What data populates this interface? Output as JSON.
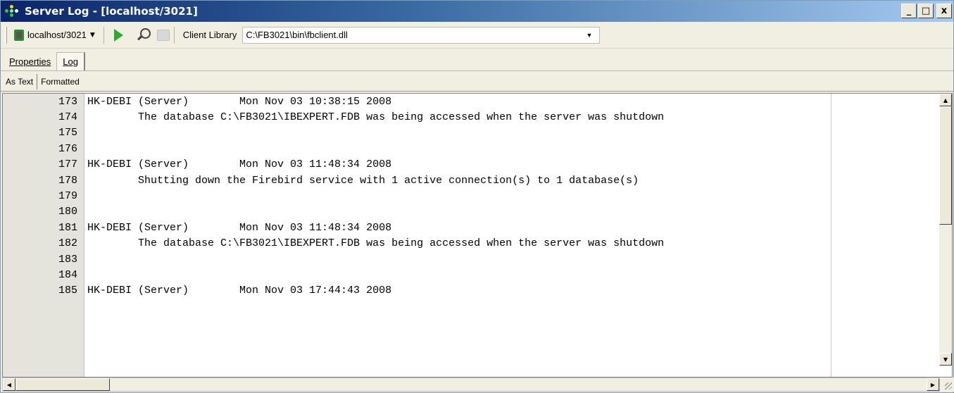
{
  "window": {
    "title": "Server Log - [localhost/3021]",
    "buttons": {
      "minimize": "_",
      "maximize": "□",
      "close": "x"
    }
  },
  "toolbar": {
    "connection": "localhost/3021",
    "client_library_label": "Client Library",
    "client_library_value": "C:\\FB3021\\bin\\fbclient.dll"
  },
  "tabs": {
    "properties": "Properties",
    "log": "Log"
  },
  "subtabs": {
    "as_text": "As Text",
    "formatted": "Formatted"
  },
  "log": {
    "lines": [
      {
        "n": "173",
        "text": "HK-DEBI (Server)        Mon Nov 03 10:38:15 2008"
      },
      {
        "n": "174",
        "text": "        The database C:\\FB3021\\IBEXPERT.FDB was being accessed when the server was shutdown"
      },
      {
        "n": "175",
        "text": ""
      },
      {
        "n": "176",
        "text": ""
      },
      {
        "n": "177",
        "text": "HK-DEBI (Server)        Mon Nov 03 11:48:34 2008"
      },
      {
        "n": "178",
        "text": "        Shutting down the Firebird service with 1 active connection(s) to 1 database(s)"
      },
      {
        "n": "179",
        "text": ""
      },
      {
        "n": "180",
        "text": ""
      },
      {
        "n": "181",
        "text": "HK-DEBI (Server)        Mon Nov 03 11:48:34 2008"
      },
      {
        "n": "182",
        "text": "        The database C:\\FB3021\\IBEXPERT.FDB was being accessed when the server was shutdown"
      },
      {
        "n": "183",
        "text": ""
      },
      {
        "n": "184",
        "text": ""
      },
      {
        "n": "185",
        "text": "HK-DEBI (Server)        Mon Nov 03 17:44:43 2008"
      }
    ]
  }
}
